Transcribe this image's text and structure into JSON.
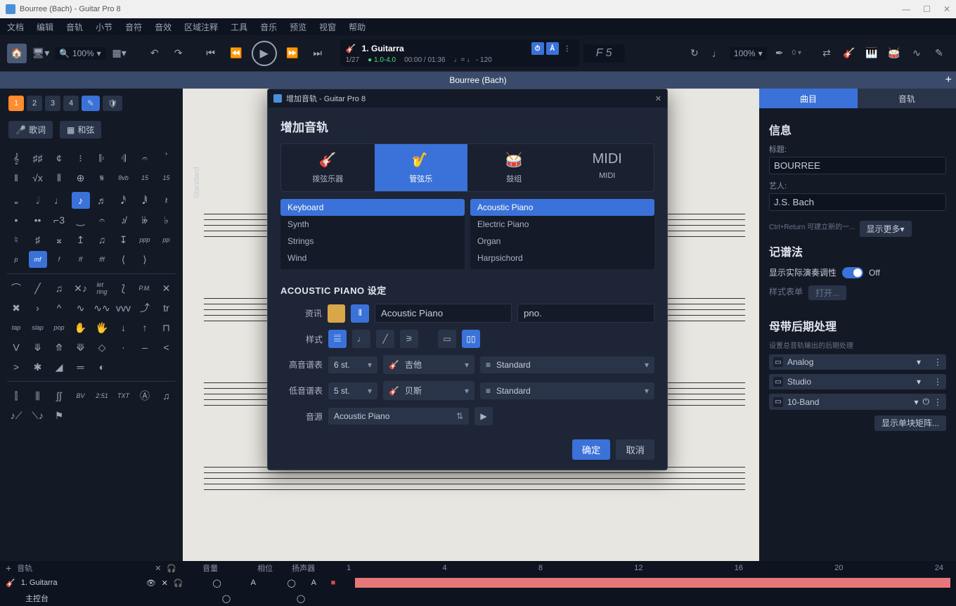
{
  "window": {
    "title": "Bourree (Bach) - Guitar Pro 8",
    "min": "—",
    "max": "☐",
    "close": "✕"
  },
  "menu": [
    "文档",
    "编辑",
    "音轨",
    "小节",
    "音符",
    "音效",
    "区域注释",
    "工具",
    "音乐",
    "预览",
    "视窗",
    "帮助"
  ],
  "toolbar": {
    "zoom": "100%",
    "track": {
      "name": "1. Guitarra",
      "progress": "1/27",
      "tempo_sig": "1.0-4.0",
      "time": "00:00 / 01:36",
      "tempo": "120"
    },
    "chord": "F 5",
    "right_pct": "100%"
  },
  "doc_tab": "Bourree (Bach)",
  "left": {
    "modes": [
      "1",
      "2",
      "3",
      "4"
    ],
    "lyric": "歌词",
    "chord": "和弦",
    "standard_label": "Standard"
  },
  "right": {
    "tab_score": "曲目",
    "tab_track": "音轨",
    "info_title": "信息",
    "title_label": "标题:",
    "title_val": "BOURREE",
    "artist_label": "艺人:",
    "artist_val": "J.S. Bach",
    "hint": "Ctrl+Return 可建立新的一...",
    "show_more": "显示更多▾",
    "notation_title": "记谱法",
    "toggle_label": "显示实际演奏调性",
    "toggle_state": "Off",
    "style_list": "样式表单",
    "apply": "打开...",
    "mastering_title": "母带后期处理",
    "mastering_desc": "设置总音轨输出的后期处理",
    "fx": [
      "Analog",
      "Studio",
      "10-Band"
    ],
    "show_matrix": "显示单块矩阵..."
  },
  "dialog": {
    "win_title": "增加音轨 - Guitar Pro 8",
    "heading": "增加音轨",
    "tabs": {
      "fretted": "拨弦乐器",
      "orchestra": "管弦乐",
      "drums": "鼓组",
      "midi": "MIDI"
    },
    "categories": [
      "Keyboard",
      "Synth",
      "Strings",
      "Wind"
    ],
    "instruments": [
      "Acoustic Piano",
      "Electric Piano",
      "Organ",
      "Harpsichord"
    ],
    "settings_title": "ACOUSTIC PIANO 设定",
    "labels": {
      "info": "资讯",
      "style": "样式",
      "treble": "高音谱表",
      "bass": "低音谱表",
      "sound": "音源"
    },
    "name_val": "Acoustic Piano",
    "short_val": "pno.",
    "treble_strings": "6 st.",
    "treble_inst": "吉他",
    "treble_tuning": "Standard",
    "bass_strings": "5 st.",
    "bass_inst": "贝斯",
    "bass_tuning": "Standard",
    "sound_val": "Acoustic Piano",
    "ok": "确定",
    "cancel": "取消"
  },
  "bottom": {
    "plus": "+",
    "track_col": "音轨",
    "vol": "音量",
    "pan": "相位",
    "speaker": "扬声器",
    "bars": [
      "1",
      "4",
      "8",
      "12",
      "16",
      "20",
      "24"
    ],
    "track_name": "1. Guitarra",
    "master": "主控台"
  }
}
